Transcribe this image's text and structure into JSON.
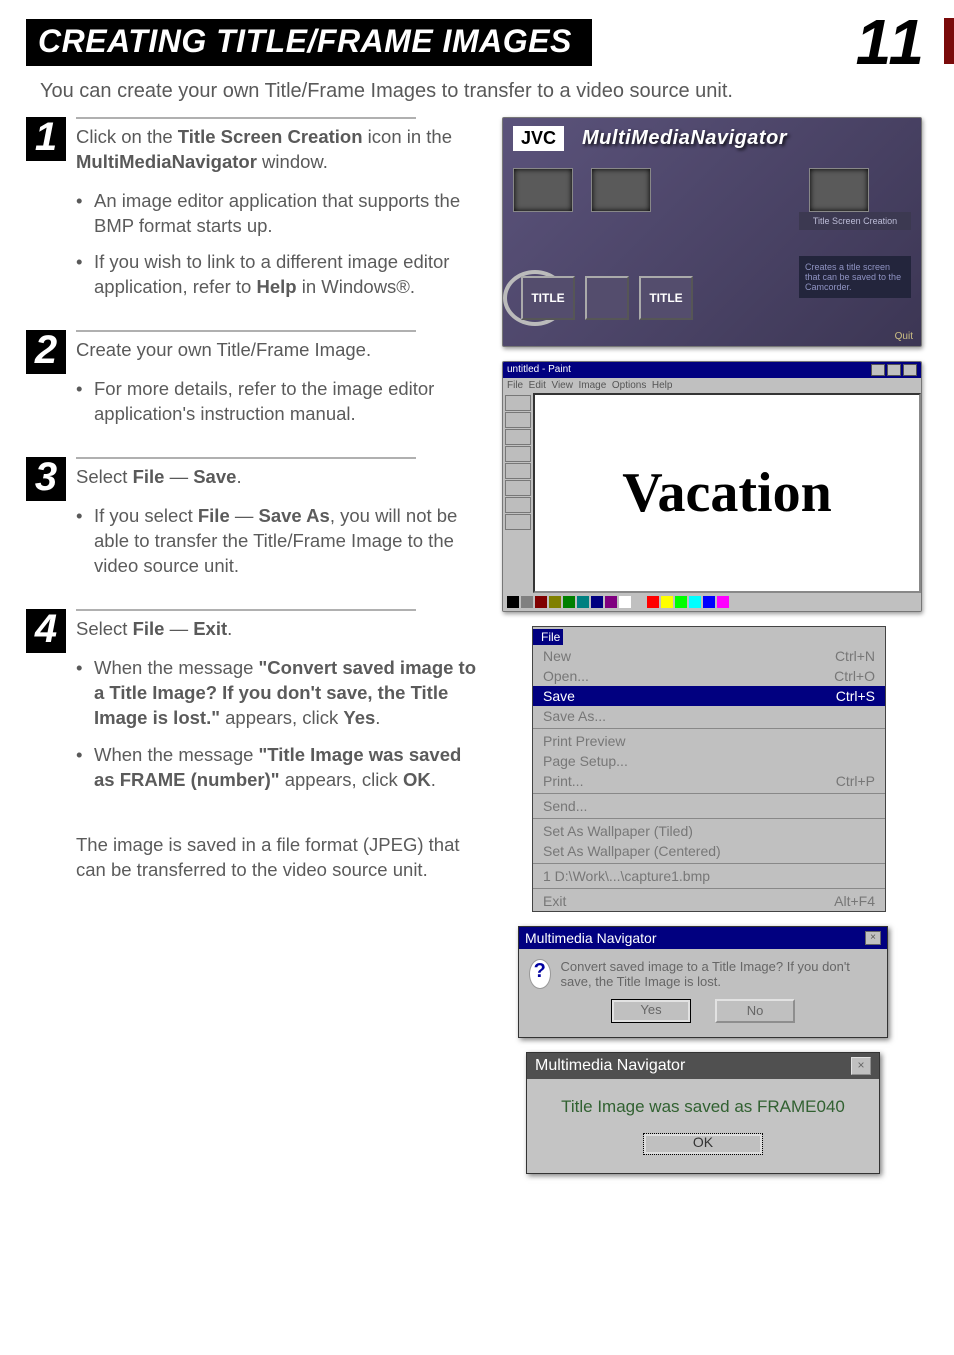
{
  "page": {
    "number": "11",
    "header": "CREATING TITLE/FRAME IMAGES",
    "intro": "You can create your own Title/Frame Images to transfer to a video source unit."
  },
  "steps": {
    "s1": {
      "num": "1",
      "lead_pre": "Click on the ",
      "lead_b1": "Title Screen Creation",
      "lead_mid": " icon in the ",
      "lead_b2": "MultiMediaNavigator",
      "lead_post": " window.",
      "b1": "An image editor application that supports the BMP format starts up.",
      "b2_pre": "If you wish to link to a different image editor application, refer to ",
      "b2_b": "Help",
      "b2_post": " in Windows®."
    },
    "s2": {
      "num": "2",
      "lead": "Create your own Title/Frame Image.",
      "b1": "For more details, refer to the image editor application's instruction manual."
    },
    "s3": {
      "num": "3",
      "lead_pre": "Select ",
      "lead_b1": "File",
      "lead_mid": " — ",
      "lead_b2": "Save",
      "lead_post": ".",
      "b1_pre": "If you select ",
      "b1_b1": "File",
      "b1_mid": " — ",
      "b1_b2": "Save As",
      "b1_post": ", you will not be able to transfer the Title/Frame Image to the video source unit."
    },
    "s4": {
      "num": "4",
      "lead_pre": "Select ",
      "lead_b1": "File",
      "lead_mid": " — ",
      "lead_b2": "Exit",
      "lead_post": ".",
      "b1_pre": "When the message ",
      "b1_b": "\"Convert saved image to a Title Image? If you don't save, the Title Image is lost.\"",
      "b1_post": " appears, click ",
      "b1_b2": "Yes",
      "b1_end": ".",
      "b2_pre": "When the message ",
      "b2_b": "\"Title Image was saved as FRAME (number)\"",
      "b2_post": " appears, click ",
      "b2_b2": "OK",
      "b2_end": ".",
      "closing": "The image is saved in a file format (JPEG) that can be transferred to the video source unit."
    }
  },
  "mmn": {
    "logo": "JVC",
    "title": "MultiMediaNavigator",
    "t1": "TITLE",
    "t2": "TITLE",
    "info2": "Title Screen Creation",
    "info": "Creates a title screen that can be saved to the Camcorder.",
    "quit": "Quit"
  },
  "paint": {
    "canvas_text": "Vacation"
  },
  "filemenu": {
    "label": "File",
    "items": [
      {
        "l": "New",
        "r": "Ctrl+N"
      },
      {
        "l": "Open...",
        "r": "Ctrl+O"
      },
      {
        "l": "Save",
        "r": "Ctrl+S",
        "sel": true
      },
      {
        "l": "Save As...",
        "r": ""
      },
      {
        "sep": true
      },
      {
        "l": "Print Preview",
        "r": ""
      },
      {
        "l": "Page Setup...",
        "r": ""
      },
      {
        "l": "Print...",
        "r": "Ctrl+P"
      },
      {
        "sep": true
      },
      {
        "l": "Send...",
        "r": ""
      },
      {
        "sep": true
      },
      {
        "l": "Set As Wallpaper (Tiled)",
        "r": ""
      },
      {
        "l": "Set As Wallpaper (Centered)",
        "r": ""
      },
      {
        "sep": true
      },
      {
        "l": "1 D:\\Work\\...\\capture1.bmp",
        "r": ""
      },
      {
        "sep": true
      },
      {
        "l": "Exit",
        "r": "Alt+F4"
      }
    ]
  },
  "dlg1": {
    "title": "Multimedia Navigator",
    "msg": "Convert saved image to a Title Image? If you don't save, the Title Image is lost.",
    "yes": "Yes",
    "no": "No"
  },
  "dlg2": {
    "title": "Multimedia Navigator",
    "msg": "Title Image was saved as FRAME040",
    "ok": "OK"
  }
}
